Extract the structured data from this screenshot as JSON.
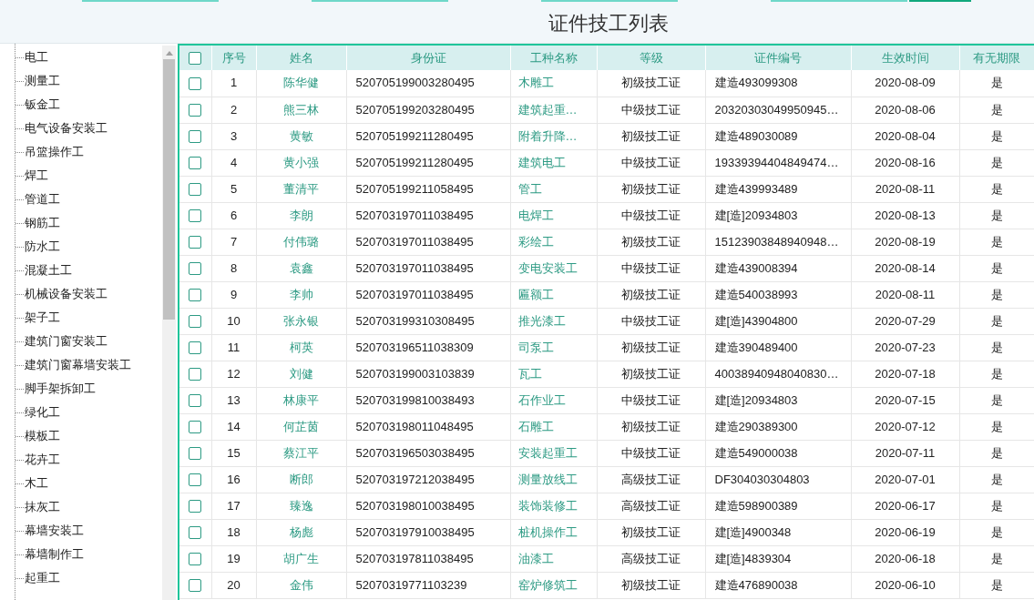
{
  "page_title": "证件技工列表",
  "sidebar": {
    "items": [
      "电工",
      "测量工",
      "钣金工",
      "电气设备安装工",
      "吊篮操作工",
      "焊工",
      "管道工",
      "钢筋工",
      "防水工",
      "混凝土工",
      "机械设备安装工",
      "架子工",
      "建筑门窗安装工",
      "建筑门窗幕墙安装工",
      "脚手架拆卸工",
      "绿化工",
      "模板工",
      "花卉工",
      "木工",
      "抹灰工",
      "幕墙安装工",
      "幕墙制作工",
      "起重工"
    ]
  },
  "table": {
    "all_checked": false,
    "columns": [
      "序号",
      "姓名",
      "身份证",
      "工种名称",
      "等级",
      "证件编号",
      "生效时间",
      "有无期限"
    ],
    "rows": [
      {
        "checked": false,
        "no": "1",
        "name": "陈华健",
        "id": "520705199003280495",
        "trade": "木雕工",
        "level": "初级技工证",
        "cert": "建造493099308",
        "date": "2020-08-09",
        "term": "是"
      },
      {
        "checked": false,
        "no": "2",
        "name": "熊三林",
        "id": "520705199203280495",
        "trade": "建筑起重…",
        "level": "中级技工证",
        "cert": "20320303049950945…",
        "date": "2020-08-06",
        "term": "是"
      },
      {
        "checked": false,
        "no": "3",
        "name": "黄敏",
        "id": "520705199211280495",
        "trade": "附着升降…",
        "level": "初级技工证",
        "cert": "建造489030089",
        "date": "2020-08-04",
        "term": "是"
      },
      {
        "checked": false,
        "no": "4",
        "name": "黄小强",
        "id": "520705199211280495",
        "trade": "建筑电工",
        "level": "中级技工证",
        "cert": "19339394404849474…",
        "date": "2020-08-16",
        "term": "是"
      },
      {
        "checked": false,
        "no": "5",
        "name": "董清平",
        "id": "520705199211058495",
        "trade": "管工",
        "level": "初级技工证",
        "cert": "建造439993489",
        "date": "2020-08-11",
        "term": "是"
      },
      {
        "checked": false,
        "no": "6",
        "name": "李朗",
        "id": "520703197011038495",
        "trade": "电焊工",
        "level": "中级技工证",
        "cert": "建[造]20934803",
        "date": "2020-08-13",
        "term": "是"
      },
      {
        "checked": false,
        "no": "7",
        "name": "付伟璐",
        "id": "520703197011038495",
        "trade": "彩绘工",
        "level": "初级技工证",
        "cert": "15123903848940948…",
        "date": "2020-08-19",
        "term": "是"
      },
      {
        "checked": false,
        "no": "8",
        "name": "袁鑫",
        "id": "520703197011038495",
        "trade": "变电安装工",
        "level": "中级技工证",
        "cert": "建造439008394",
        "date": "2020-08-14",
        "term": "是"
      },
      {
        "checked": false,
        "no": "9",
        "name": "李帅",
        "id": "520703197011038495",
        "trade": "匾额工",
        "level": "初级技工证",
        "cert": "建造540038993",
        "date": "2020-08-11",
        "term": "是"
      },
      {
        "checked": false,
        "no": "10",
        "name": "张永银",
        "id": "520703199310308495",
        "trade": "推光漆工",
        "level": "中级技工证",
        "cert": "建[造]43904800",
        "date": "2020-07-29",
        "term": "是"
      },
      {
        "checked": false,
        "no": "11",
        "name": "柯英",
        "id": "520703196511038309",
        "trade": "司泵工",
        "level": "初级技工证",
        "cert": "建造390489400",
        "date": "2020-07-23",
        "term": "是"
      },
      {
        "checked": false,
        "no": "12",
        "name": "刘健",
        "id": "520703199003103839",
        "trade": "瓦工",
        "level": "初级技工证",
        "cert": "40038940948040830…",
        "date": "2020-07-18",
        "term": "是"
      },
      {
        "checked": false,
        "no": "13",
        "name": "林康平",
        "id": "520703199810038493",
        "trade": "石作业工",
        "level": "中级技工证",
        "cert": "建[造]20934803",
        "date": "2020-07-15",
        "term": "是"
      },
      {
        "checked": false,
        "no": "14",
        "name": "何芷茵",
        "id": "520703198011048495",
        "trade": "石雕工",
        "level": "初级技工证",
        "cert": "建造290389300",
        "date": "2020-07-12",
        "term": "是"
      },
      {
        "checked": false,
        "no": "15",
        "name": "蔡江平",
        "id": "520703196503038495",
        "trade": "安装起重工",
        "level": "中级技工证",
        "cert": "建造549000038",
        "date": "2020-07-11",
        "term": "是"
      },
      {
        "checked": false,
        "no": "16",
        "name": "断郎",
        "id": "520703197212038495",
        "trade": "测量放线工",
        "level": "高级技工证",
        "cert": "DF304030304803",
        "date": "2020-07-01",
        "term": "是"
      },
      {
        "checked": false,
        "no": "17",
        "name": "臻逸",
        "id": "520703198010038495",
        "trade": "装饰装修工",
        "level": "高级技工证",
        "cert": "建造598900389",
        "date": "2020-06-17",
        "term": "是"
      },
      {
        "checked": false,
        "no": "18",
        "name": "杨彪",
        "id": "520703197910038495",
        "trade": "桩机操作工",
        "level": "初级技工证",
        "cert": "建[造]4900348",
        "date": "2020-06-19",
        "term": "是"
      },
      {
        "checked": false,
        "no": "19",
        "name": "胡广生",
        "id": "520703197811038495",
        "trade": "油漆工",
        "level": "高级技工证",
        "cert": "建[造]4839304",
        "date": "2020-06-18",
        "term": "是"
      },
      {
        "checked": false,
        "no": "20",
        "name": "金伟",
        "id": "52070319771103239",
        "trade": "窑炉修筑工",
        "level": "初级技工证",
        "cert": "建造476890038",
        "date": "2020-06-10",
        "term": "是"
      }
    ]
  }
}
